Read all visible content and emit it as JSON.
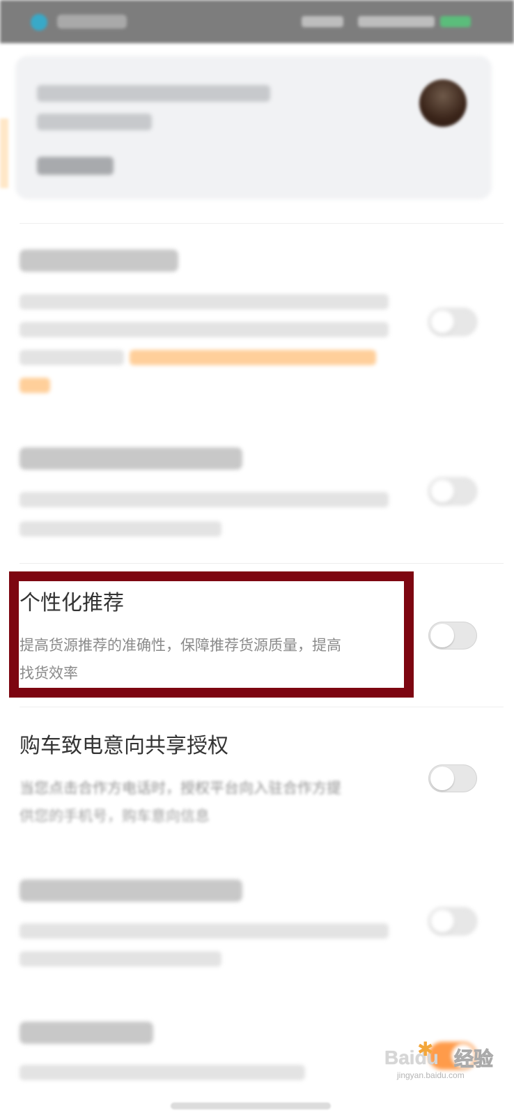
{
  "personalized_recommendation": {
    "title": "个性化推荐",
    "description_line1": "提高货源推荐的准确性，保障推荐货源质量，提高",
    "description_line2": "找货效率",
    "toggle_on": false
  },
  "call_intent_authorization": {
    "title": "购车致电意向共享授权",
    "description_line1": "当您点击合作方电话时，授权平台向入驻合作方提",
    "description_line2": "供您的手机号，购车意向信息",
    "toggle_on": false
  },
  "watermark": {
    "brand": "Baidu",
    "label": "经验",
    "url": "jingyan.baidu.com"
  },
  "colors": {
    "highlight_border": "#7d0611",
    "toggle_off": "#e7e7e7",
    "toggle_on": "#ff9b4a"
  }
}
